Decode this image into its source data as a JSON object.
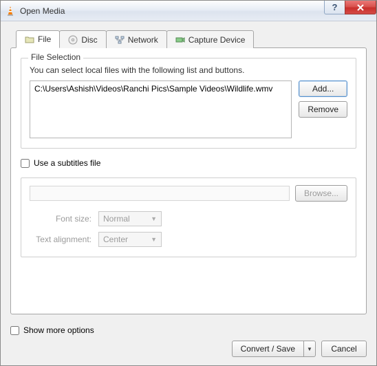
{
  "window": {
    "title": "Open Media"
  },
  "tabs": {
    "file": "File",
    "disc": "Disc",
    "network": "Network",
    "capture": "Capture Device"
  },
  "fileSelection": {
    "legend": "File Selection",
    "hint": "You can select local files with the following list and buttons.",
    "files": [
      "C:\\Users\\Ashish\\Videos\\Ranchi Pics\\Sample Videos\\Wildlife.wmv"
    ],
    "addLabel": "Add...",
    "removeLabel": "Remove"
  },
  "subtitles": {
    "checkboxLabel": "Use a subtitles file",
    "browseLabel": "Browse...",
    "fontSizeLabel": "Font size:",
    "fontSizeValue": "Normal",
    "alignLabel": "Text alignment:",
    "alignValue": "Center"
  },
  "footer": {
    "showMoreLabel": "Show more options",
    "convertLabel": "Convert / Save",
    "cancelLabel": "Cancel"
  }
}
